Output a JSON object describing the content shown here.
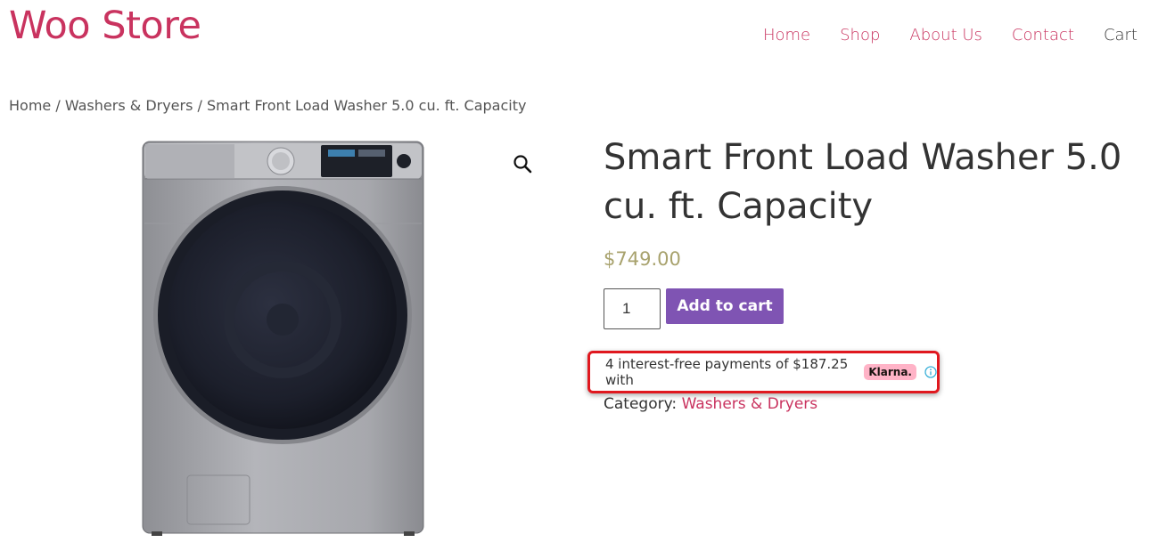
{
  "site": {
    "title": "Woo Store"
  },
  "nav": {
    "items": [
      "Home",
      "Shop",
      "About Us",
      "Contact",
      "Cart"
    ]
  },
  "breadcrumb": {
    "items": [
      "Home",
      "Washers & Dryers",
      "Smart Front Load Washer 5.0 cu. ft. Capacity"
    ],
    "separator": "/"
  },
  "product": {
    "title": "Smart Front Load Washer 5.0 cu. ft. Capacity",
    "price": "$749.00",
    "quantity": "1",
    "add_to_cart_label": "Add to cart",
    "klarna": {
      "text": "4 interest-free payments of $187.25 with",
      "badge": "Klarna."
    },
    "category_label": "Category:",
    "category_value": "Washers & Dryers",
    "image_icon": "washing-machine-image",
    "zoom_icon": "magnifier-icon"
  },
  "colors": {
    "brand": "#c9335f",
    "button": "#7f54b3",
    "price": "#a8a26d",
    "klarna_pink": "#ffb3c7",
    "highlight": "#e0181f"
  }
}
